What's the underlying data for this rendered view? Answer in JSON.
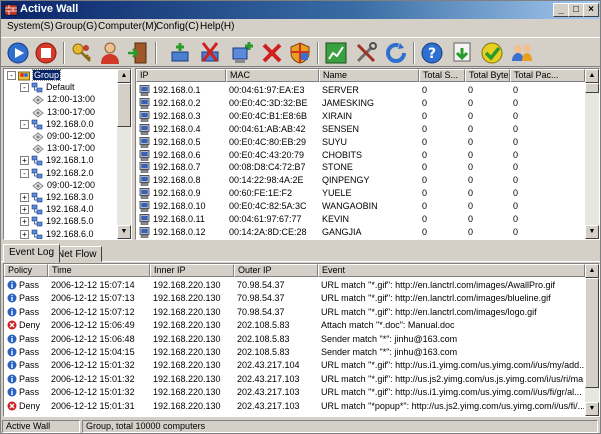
{
  "window": {
    "title": "Active Wall"
  },
  "menu": [
    "System(S)",
    "Group(G)",
    "Computer(M)",
    "Config(C)",
    "Help(H)"
  ],
  "tree": [
    {
      "label": "Group",
      "level": 0,
      "expander": "-",
      "icon": "group-icon",
      "selected": true
    },
    {
      "label": "Default",
      "level": 1,
      "expander": "-",
      "icon": "network-icon"
    },
    {
      "label": "12:00-13:00",
      "level": 2,
      "expander": "",
      "icon": "schedule-icon"
    },
    {
      "label": "13:00-17:00",
      "level": 2,
      "expander": "",
      "icon": "schedule-icon"
    },
    {
      "label": "192.168.0.0",
      "level": 1,
      "expander": "-",
      "icon": "network-icon"
    },
    {
      "label": "09:00-12:00",
      "level": 2,
      "expander": "",
      "icon": "schedule-icon"
    },
    {
      "label": "13:00-17:00",
      "level": 2,
      "expander": "",
      "icon": "schedule-icon"
    },
    {
      "label": "192.168.1.0",
      "level": 1,
      "expander": "+",
      "icon": "network-icon"
    },
    {
      "label": "192.168.2.0",
      "level": 1,
      "expander": "-",
      "icon": "network-icon"
    },
    {
      "label": "09:00-12:00",
      "level": 2,
      "expander": "",
      "icon": "schedule-icon"
    },
    {
      "label": "192.168.3.0",
      "level": 1,
      "expander": "+",
      "icon": "network-icon"
    },
    {
      "label": "192.168.4.0",
      "level": 1,
      "expander": "+",
      "icon": "network-icon"
    },
    {
      "label": "192.168.5.0",
      "level": 1,
      "expander": "+",
      "icon": "network-icon"
    },
    {
      "label": "192.168.6.0",
      "level": 1,
      "expander": "+",
      "icon": "network-icon"
    }
  ],
  "computers": {
    "columns": [
      "IP",
      "MAC",
      "Name",
      "Total S...",
      "Total Byte",
      "Total Pac..."
    ],
    "rows": [
      [
        "192.168.0.1",
        "00:04:61:97:EA:E3",
        "SERVER",
        "0",
        "0",
        "0"
      ],
      [
        "192.168.0.2",
        "00:E0:4C:3D:32:BE",
        "JAMESKING",
        "0",
        "0",
        "0"
      ],
      [
        "192.168.0.3",
        "00:E0:4C:B1:E8:6B",
        "XIRAIN",
        "0",
        "0",
        "0"
      ],
      [
        "192.168.0.4",
        "00:04:61:AB:AB:42",
        "SENSEN",
        "0",
        "0",
        "0"
      ],
      [
        "192.168.0.5",
        "00:E0:4C:80:EB:29",
        "SUYU",
        "0",
        "0",
        "0"
      ],
      [
        "192.168.0.6",
        "00:E0:4C:43:20:79",
        "CHOBITS",
        "0",
        "0",
        "0"
      ],
      [
        "192.168.0.7",
        "00:08:D8:C4:72:B7",
        "STONE",
        "0",
        "0",
        "0"
      ],
      [
        "192.168.0.8",
        "00:14:22:98:4A:2E",
        "QINPENGY",
        "0",
        "0",
        "0"
      ],
      [
        "192.168.0.9",
        "00:60:FE:1E:F2",
        "YUELE",
        "0",
        "0",
        "0"
      ],
      [
        "192.168.0.10",
        "00:E0:4C:82:5A:3C",
        "WANGAOBIN",
        "0",
        "0",
        "0"
      ],
      [
        "192.168.0.11",
        "00:04:61:97:67:77",
        "KEVIN",
        "0",
        "0",
        "0"
      ],
      [
        "192.168.0.12",
        "00:14:2A:8D:CE:28",
        "GANGJIA",
        "0",
        "0",
        "0"
      ]
    ]
  },
  "tabs": [
    "Event Log",
    "Net Flow"
  ],
  "log": {
    "columns": [
      "Policy",
      "Time",
      "Inner IP",
      "Outer IP",
      "Event"
    ],
    "rows": [
      {
        "policy": "Pass",
        "time": "2006-12-12 15:07:14",
        "inner": "192.168.220.130",
        "outer": "70.98.54.37",
        "event": "URL match \"*.gif\": http://en.lanctrl.com/images/AwallPro.gif"
      },
      {
        "policy": "Pass",
        "time": "2006-12-12 15:07:13",
        "inner": "192.168.220.130",
        "outer": "70.98.54.37",
        "event": "URL match \"*.gif\": http://en.lanctrl.com/images/blueline.gif"
      },
      {
        "policy": "Pass",
        "time": "2006-12-12 15:07:12",
        "inner": "192.168.220.130",
        "outer": "70.98.54.37",
        "event": "URL match \"*.gif\": http://en.lanctrl.com/images/logo.gif"
      },
      {
        "policy": "Deny",
        "time": "2006-12-12 15:06:49",
        "inner": "192.168.220.130",
        "outer": "202.108.5.83",
        "event": "Attach match \"*.doc\": Manual.doc"
      },
      {
        "policy": "Pass",
        "time": "2006-12-12 15:06:48",
        "inner": "192.168.220.130",
        "outer": "202.108.5.83",
        "event": "Sender match \"*\": jinhu@163.com"
      },
      {
        "policy": "Pass",
        "time": "2006-12-12 15:04:15",
        "inner": "192.168.220.130",
        "outer": "202.108.5.83",
        "event": "Sender match \"*\": jinhu@163.com"
      },
      {
        "policy": "Pass",
        "time": "2006-12-12 15:01:32",
        "inner": "192.168.220.130",
        "outer": "202.43.217.104",
        "event": "URL match \"*.gif\": http://us.i1.yimg.com/us.yimg.com/i/us/my/add..."
      },
      {
        "policy": "Pass",
        "time": "2006-12-12 15:01:32",
        "inner": "192.168.220.130",
        "outer": "202.43.217.103",
        "event": "URL match \"*.gif\": http://us.js2.yimg.com/us.js.yimg.com/i/us/ri/ma..."
      },
      {
        "policy": "Pass",
        "time": "2006-12-12 15:01:32",
        "inner": "192.168.220.130",
        "outer": "202.43.217.103",
        "event": "URL match \"*.gif\": http://us.i1.yimg.com/us.yimg.com/i/us/fi/gr/al..."
      },
      {
        "policy": "Deny",
        "time": "2006-12-12 15:01:31",
        "inner": "192.168.220.130",
        "outer": "202.43.217.103",
        "event": "URL match \"*popup*\": http://us.js2.yimg.com/us.yimg.com/i/us/fi/..."
      }
    ]
  },
  "status": {
    "left": "Active Wall",
    "right": "Group, total 10000 computers"
  },
  "colors": {
    "pass": "#2a5fc4",
    "deny": "#d02020",
    "titlebar": "#0a246a"
  }
}
